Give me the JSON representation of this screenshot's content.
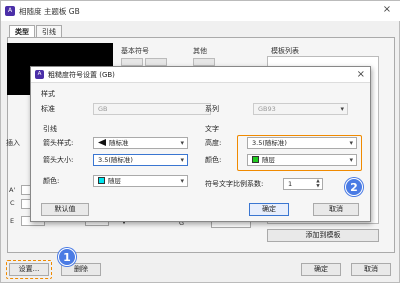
{
  "outer": {
    "title": "相随度 主题板 GB",
    "close": "×",
    "tabs": [
      "类型",
      "引线"
    ],
    "basic_symbol_label": "基本符号",
    "other_label": "其他",
    "template_list_label": "模板列表",
    "insert_label": "插入",
    "row_labels": [
      "A'",
      "C",
      "E"
    ],
    "right_labels": [
      "F",
      "G"
    ],
    "add_template_button": "添加到模板",
    "settings_button": "设置...",
    "delete_button": "删除",
    "ok_button": "确定",
    "cancel_button": "取消"
  },
  "badges": [
    "1",
    "2"
  ],
  "dialog": {
    "title": "粗糙度符号设置 (GB)",
    "close": "×",
    "style_section": "样式",
    "standard_label": "标准",
    "standard_value": "GB",
    "series_label": "系列",
    "series_value": "GB93",
    "leader_section": "引线",
    "arrow_style_label": "箭头样式:",
    "arrow_style_value": "随标准",
    "arrow_size_label": "箭头大小:",
    "arrow_size_value": "3.5(随标准)",
    "color_label": "颜色:",
    "color_value": "随层",
    "text_section": "文字",
    "height_label": "高度:",
    "height_value": "3.5(随标准)",
    "text_color_label": "颜色:",
    "text_color_value": "随层",
    "ratio_label": "符号文字比例系数:",
    "ratio_value": "1",
    "default_button": "默认值",
    "ok_button": "确定",
    "cancel_button": "取消"
  },
  "colors": {
    "leader_color_swatch": "#00e5ee",
    "text_color_swatch": "#22cc22",
    "highlight": "#f08a00",
    "badge": "#4a7be4"
  },
  "icons": [
    "app-icon",
    "close-icon",
    "chevron-down-icon",
    "arrow-icon",
    "spin-icon"
  ]
}
